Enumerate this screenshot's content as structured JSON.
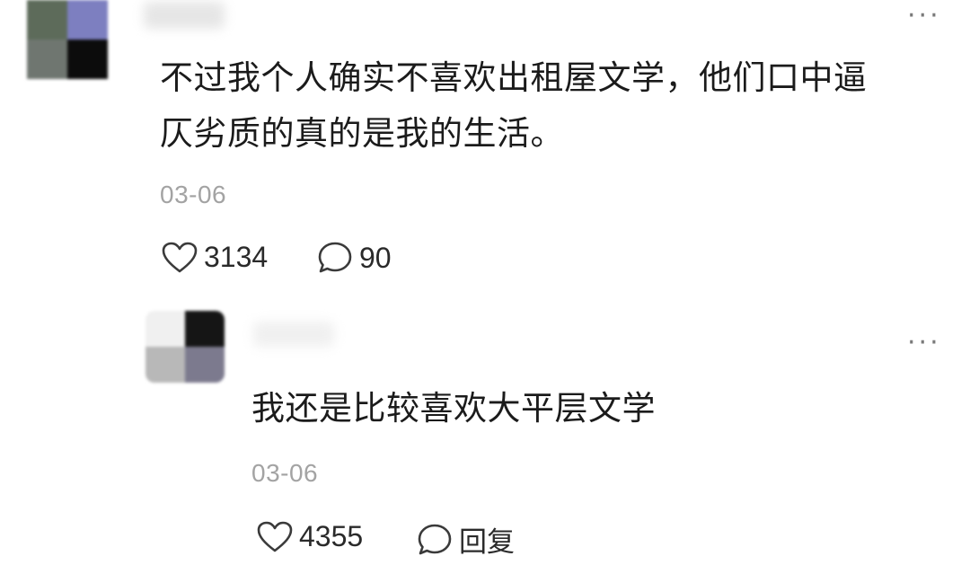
{
  "comment": {
    "text_line1": "不过我个人确实不喜欢出租屋文学，他们口中逼",
    "text_line2": "仄劣质的真的是我的生活。",
    "date": "03-06",
    "likes": "3134",
    "replies": "90",
    "icons": {
      "like": "heart-outline-icon",
      "comment": "speech-bubble-icon",
      "more": "more-dots-icon"
    }
  },
  "reply": {
    "text": "我还是比较喜欢大平层文学",
    "date": "03-06",
    "likes": "4355",
    "reply_label": "回复",
    "icons": {
      "like": "heart-outline-icon",
      "reply": "speech-bubble-icon",
      "more": "more-dots-icon"
    }
  },
  "more_glyph": "···",
  "colors": {
    "text": "#1b1b1b",
    "muted": "#a3a3a3",
    "icon": "#3a3a3a",
    "background": "#ffffff"
  }
}
